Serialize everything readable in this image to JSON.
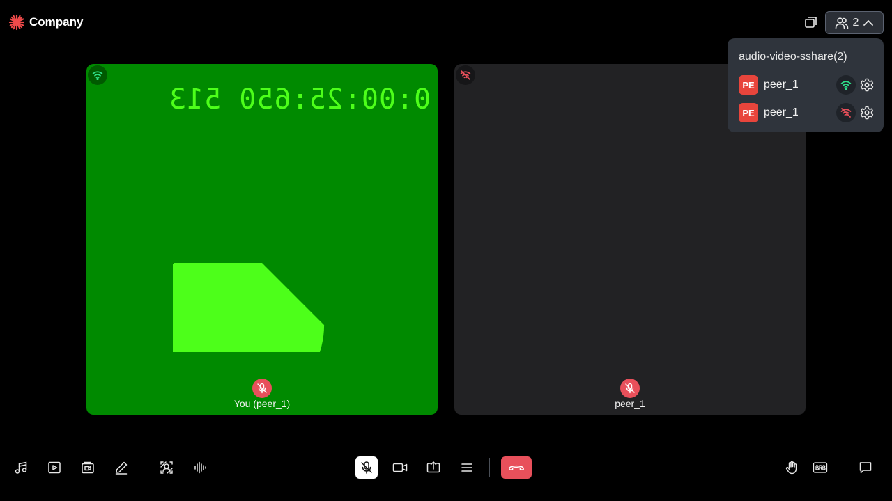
{
  "header": {
    "brand_name": "Company",
    "participants_count": "2"
  },
  "tiles": [
    {
      "name": "You (peer_1)",
      "timer_text": "0:00:25:650 513",
      "network": "good",
      "pie_fill_percent": 62.5
    },
    {
      "name": "peer_1",
      "network": "poor"
    }
  ],
  "participants_popup": {
    "title": "audio-video-sshare(2)",
    "participants": [
      {
        "initials": "PE",
        "name": "peer_1",
        "network": "good"
      },
      {
        "initials": "PE",
        "name": "peer_1",
        "network": "poor"
      }
    ]
  },
  "toolbar": {
    "left": [
      "music-icon",
      "video-playlist-icon",
      "video-file-icon",
      "pencil-icon",
      "virtual-background-icon",
      "audio-waveform-icon"
    ],
    "center": [
      "mic-off-icon",
      "camera-icon",
      "screen-share-icon",
      "menu-icon",
      "leave-call-icon"
    ],
    "right": [
      "hand-raise-icon",
      "brb-icon",
      "chat-icon"
    ]
  },
  "colors": {
    "tile_self_bg": "#008a00",
    "tile_peer_bg": "#222224",
    "timer_color": "#4dff1a",
    "muted_badge": "#e8505b",
    "leave_button": "#e8505b",
    "avatar_bg": "#e8453c",
    "network_good": "#2fe08a",
    "network_poor": "#e8505b"
  }
}
